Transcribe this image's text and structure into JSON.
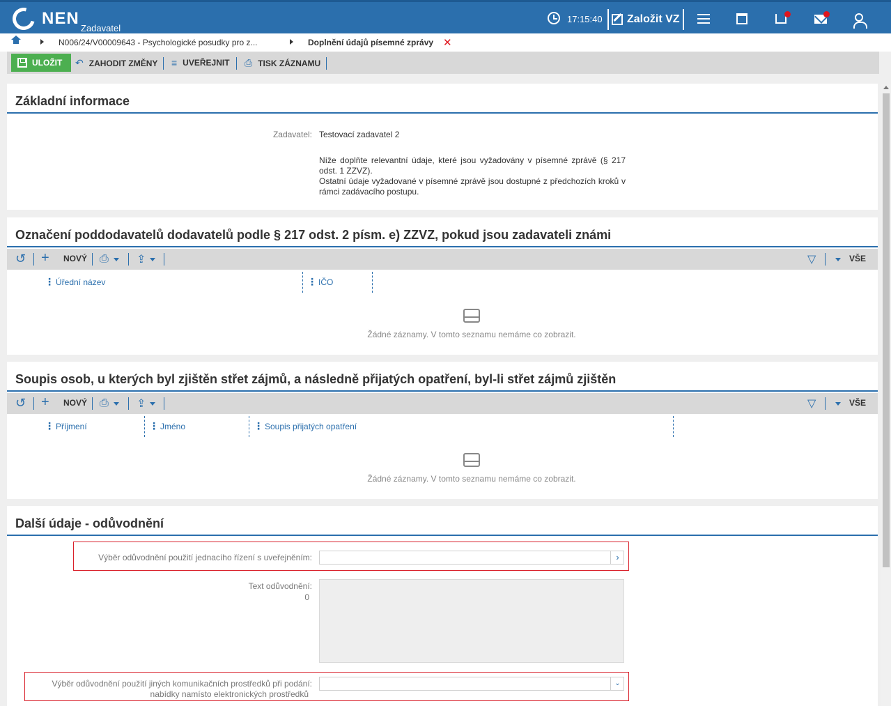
{
  "header": {
    "logo": "NEN",
    "logo_sub": "Zadavatel",
    "time": "17:15:40",
    "create_label": "Založit VZ"
  },
  "breadcrumb": {
    "item1": "N006/24/V00009643 - Psychologické posudky pro z...",
    "item2": "Doplnění údajů písemné zprávy"
  },
  "toolbar": {
    "save_label": "ULOŽIT",
    "discard_label": "ZAHODIT ZMĚNY",
    "publish_label": "UVEŘEJNIT",
    "print_label": "TISK ZÁZNAMU"
  },
  "basic": {
    "title": "Základní informace",
    "zadavatel_label": "Zadavatel:",
    "zadavatel_value": "Testovací zadavatel 2",
    "note1": "Níže doplňte relevantní údaje, které jsou vyžadovány v písemné zprávě (§ 217 odst. 1 ZZVZ).",
    "note2": "Ostatní údaje vyžadované v písemné zprávě jsou dostupné z předchozích kroků v rámci zadávacího postupu."
  },
  "subcontractors": {
    "title": "Označení poddodavatelů dodavatelů podle § 217 odst. 2 písm. e) ZZVZ, pokud jsou zadavateli známi",
    "new_label": "NOVÝ",
    "all_label": "VŠE",
    "columns": [
      "Úřední název",
      "IČO"
    ],
    "empty": "Žádné záznamy. V tomto seznamu nemáme co zobrazit."
  },
  "conflicts": {
    "title": "Soupis osob, u kterých byl zjištěn střet zájmů, a následně přijatých opatření, byl-li střet zájmů zjištěn",
    "new_label": "NOVÝ",
    "all_label": "VŠE",
    "columns": [
      "Příjmení",
      "Jméno",
      "Soupis přijatých opatření"
    ],
    "empty": "Žádné záznamy. V tomto seznamu nemáme co zobrazit."
  },
  "justification": {
    "title": "Další údaje - odůvodnění",
    "select1_label": "Výběr odůvodnění použití jednacího řízení s uveřejněním:",
    "text_label": "Text odůvodnění:",
    "text_count": "0",
    "select2_label_line1": "Výběr odůvodnění použití jiných komunikačních prostředků při podání:",
    "select2_label_line2": "nabídky namísto elektronických prostředků"
  }
}
